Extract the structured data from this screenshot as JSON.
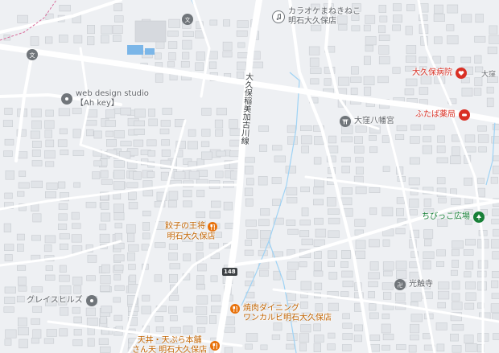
{
  "map": {
    "road_label": "大久保稲美加古川線",
    "route_number": "148",
    "colors": {
      "background": "#eef0f3",
      "road": "#ffffff",
      "building": "#e1e4e8",
      "building_edge": "#c9ccd1",
      "water": "#9fd3f5",
      "poi_red": "#d93025",
      "poi_orange": "#e8710a",
      "poi_green": "#188038",
      "poi_gray": "#70757a"
    },
    "pois": [
      {
        "id": "karaoke",
        "lines": [
          "カラオケまねきねこ",
          "明石大久保店"
        ],
        "icon": "music-note-icon",
        "color": "gray"
      },
      {
        "id": "school-top",
        "lines": [
          ""
        ],
        "icon": "school-icon",
        "color": "gray"
      },
      {
        "id": "school-left",
        "lines": [
          ""
        ],
        "icon": "school-icon",
        "color": "gray"
      },
      {
        "id": "webdesign",
        "lines": [
          "web design studio",
          "【Ah key】"
        ],
        "icon": "pin-icon",
        "color": "gray"
      },
      {
        "id": "hospital",
        "lines": [
          "大久保病院"
        ],
        "icon": "hospital-icon",
        "color": "red"
      },
      {
        "id": "okubo-area",
        "lines": [
          "大窪"
        ],
        "icon": "",
        "color": "gray"
      },
      {
        "id": "pharmacy",
        "lines": [
          "ふたば薬局"
        ],
        "icon": "pharmacy-icon",
        "color": "red"
      },
      {
        "id": "shrine",
        "lines": [
          "大窪八幡宮"
        ],
        "icon": "shrine-icon",
        "color": "gray"
      },
      {
        "id": "chibikko",
        "lines": [
          "ちびっこ広場"
        ],
        "icon": "park-icon",
        "color": "green"
      },
      {
        "id": "gyoza",
        "lines": [
          "餃子の王将",
          "明石大久保店"
        ],
        "icon": "restaurant-icon",
        "color": "orange"
      },
      {
        "id": "temple",
        "lines": [
          "光触寺"
        ],
        "icon": "temple-icon",
        "color": "gray"
      },
      {
        "id": "grace",
        "lines": [
          "グレイスヒルズ"
        ],
        "icon": "pin-icon",
        "color": "gray"
      },
      {
        "id": "yakiniku",
        "lines": [
          "焼肉ダイニング",
          "ワンカルビ明石大久保店"
        ],
        "icon": "restaurant-icon",
        "color": "orange"
      },
      {
        "id": "tempura",
        "lines": [
          "天丼・天ぷら本舗",
          "さん天 明石大久保店"
        ],
        "icon": "restaurant-icon",
        "color": "orange"
      }
    ]
  }
}
